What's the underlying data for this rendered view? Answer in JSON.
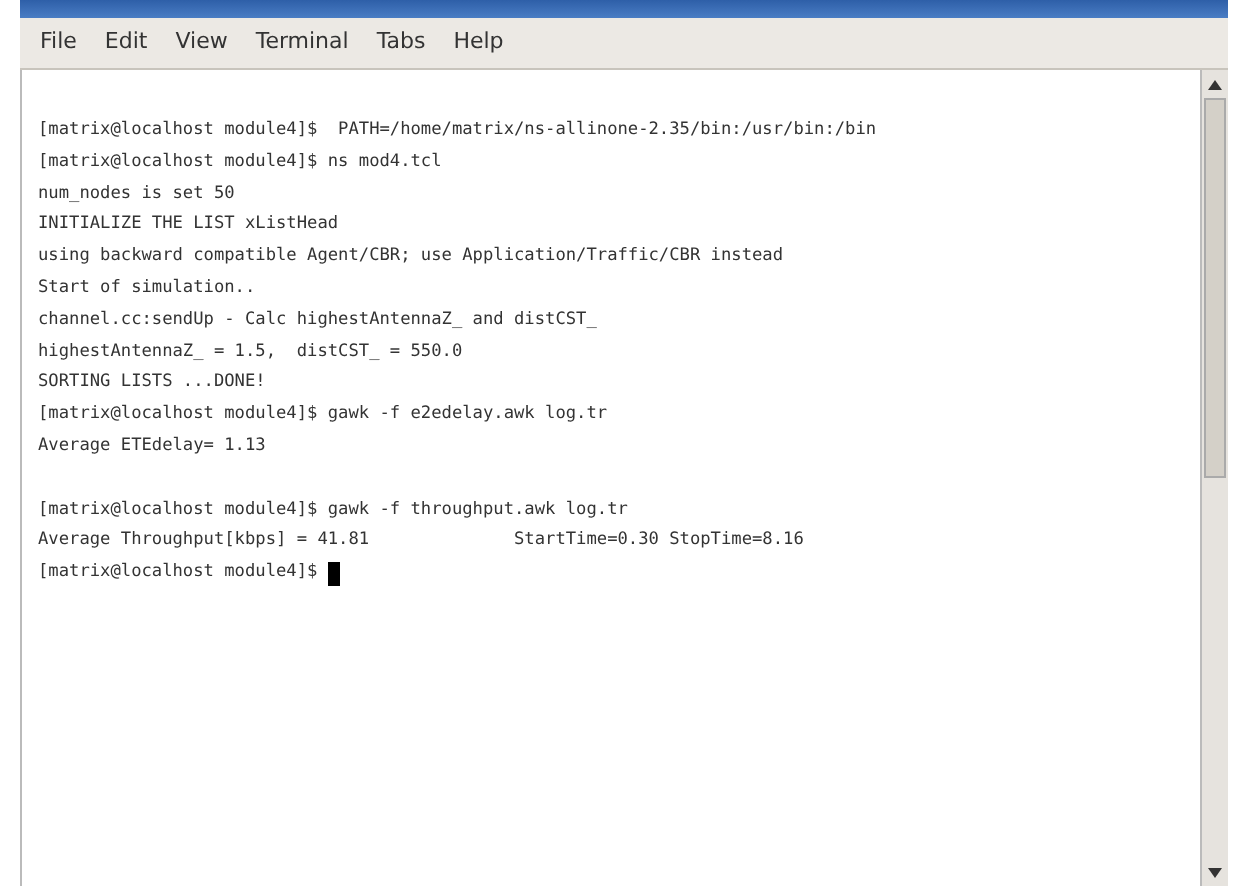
{
  "menu": [
    "File",
    "Edit",
    "View",
    "Terminal",
    "Tabs",
    "Help"
  ],
  "terminal_lines": [
    {
      "kind": "text",
      "text": "[matrix@localhost module4]$  PATH=/home/matrix/ns-allinone-2.35/bin:/usr/bin:/bin"
    },
    {
      "kind": "text",
      "text": "[matrix@localhost module4]$ ns mod4.tcl"
    },
    {
      "kind": "text",
      "text": "num_nodes is set 50"
    },
    {
      "kind": "text",
      "text": "INITIALIZE THE LIST xListHead"
    },
    {
      "kind": "text",
      "text": "using backward compatible Agent/CBR; use Application/Traffic/CBR instead"
    },
    {
      "kind": "text",
      "text": "Start of simulation.."
    },
    {
      "kind": "text",
      "text": "channel.cc:sendUp - Calc highestAntennaZ_ and distCST_"
    },
    {
      "kind": "text",
      "text": "highestAntennaZ_ = 1.5,  distCST_ = 550.0"
    },
    {
      "kind": "text",
      "text": "SORTING LISTS ...DONE!"
    },
    {
      "kind": "text",
      "text": "[matrix@localhost module4]$ gawk -f e2edelay.awk log.tr"
    },
    {
      "kind": "text",
      "text": "Average ETEdelay= 1.13"
    },
    {
      "kind": "blank"
    },
    {
      "kind": "text",
      "text": "[matrix@localhost module4]$ gawk -f throughput.awk log.tr"
    },
    {
      "kind": "text",
      "text": "Average Throughput[kbps] = 41.81              StartTime=0.30 StopTime=8.16"
    },
    {
      "kind": "text",
      "text": "[matrix@localhost module4]$ "
    }
  ],
  "cursor": true
}
